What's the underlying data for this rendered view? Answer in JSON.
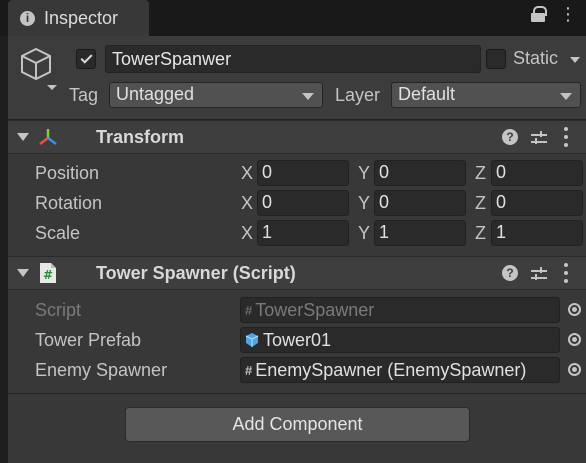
{
  "window": {
    "tab_title": "Inspector",
    "tab_icon": "info-icon"
  },
  "gameobject": {
    "active": true,
    "name": "TowerSpanwer",
    "static_label": "Static",
    "static": false,
    "tag_label": "Tag",
    "tag_value": "Untagged",
    "layer_label": "Layer",
    "layer_value": "Default"
  },
  "transform": {
    "title": "Transform",
    "rows": [
      {
        "label": "Position",
        "x": "0",
        "y": "0",
        "z": "0"
      },
      {
        "label": "Rotation",
        "x": "0",
        "y": "0",
        "z": "0"
      },
      {
        "label": "Scale",
        "x": "1",
        "y": "1",
        "z": "1"
      }
    ],
    "axis_labels": {
      "x": "X",
      "y": "Y",
      "z": "Z"
    }
  },
  "script_component": {
    "title": "Tower Spawner (Script)",
    "fields": [
      {
        "label": "Script",
        "value": "TowerSpawner",
        "icon": "script-icon",
        "disabled": true
      },
      {
        "label": "Tower Prefab",
        "value": "Tower01",
        "icon": "prefab-cube-icon",
        "disabled": false
      },
      {
        "label": "Enemy Spawner",
        "value": "EnemySpawner (EnemySpawner)",
        "icon": "script-icon",
        "disabled": false
      }
    ]
  },
  "footer": {
    "add_component_label": "Add Component"
  },
  "colors": {
    "panel_bg": "#383838",
    "field_bg": "#2a2a2a",
    "accent_blue": "#4fa3e6",
    "gizmo_red": "#e8503a",
    "gizmo_green": "#7bd13a",
    "gizmo_blue": "#3a8ce8"
  }
}
